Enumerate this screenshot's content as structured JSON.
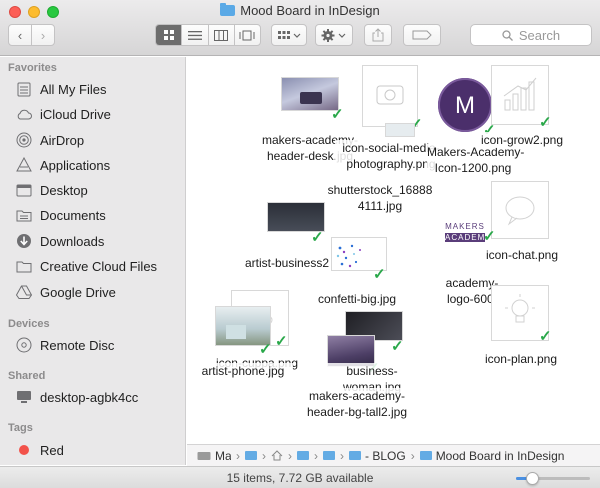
{
  "window": {
    "title": "Mood Board in InDesign"
  },
  "toolbar": {
    "back_glyph": "‹",
    "forward_glyph": "›",
    "share_glyph": "⇧",
    "search_placeholder": "Search"
  },
  "sidebar": {
    "sections": [
      {
        "label": "Favorites"
      },
      {
        "label": "Devices"
      },
      {
        "label": "Shared"
      },
      {
        "label": "Tags"
      }
    ],
    "favorites": [
      {
        "label": "All My Files",
        "icon": "all-files-icon"
      },
      {
        "label": "iCloud Drive",
        "icon": "cloud-icon"
      },
      {
        "label": "AirDrop",
        "icon": "airdrop-icon"
      },
      {
        "label": "Applications",
        "icon": "applications-icon"
      },
      {
        "label": "Desktop",
        "icon": "desktop-icon"
      },
      {
        "label": "Documents",
        "icon": "documents-icon"
      },
      {
        "label": "Downloads",
        "icon": "downloads-icon"
      },
      {
        "label": "Creative Cloud Files",
        "icon": "folder-icon"
      },
      {
        "label": "Google Drive",
        "icon": "google-drive-icon"
      }
    ],
    "devices": [
      {
        "label": "Remote Disc",
        "icon": "disc-icon"
      }
    ],
    "shared": [
      {
        "label": "desktop-agbk4cc",
        "icon": "computer-icon"
      }
    ],
    "tags": [
      {
        "label": "Red",
        "color": "#f2524a"
      }
    ]
  },
  "files": {
    "makers_academy_header_desk": "makers-academy-\nheader-desk.jpg",
    "icon_social_media_photography": "icon-social-media-\nphotography.png",
    "makers_academy_icon_1200": "Makers-Academy-\nIcon-1200.png",
    "icon_grow2": "icon-grow2.png",
    "shutterstock": "shutterstock_16888\n4111.jpg",
    "artist_business2": "artist-business2",
    "confetti_big": "confetti-big.jpg",
    "icon_chat": "icon-chat.png",
    "academy_logo_600": "academy-\nlogo-600.",
    "icon_cuppa": "icon-cuppa.png",
    "artist_phone": "artist-phone.jpg",
    "business_woman": "business-\nwoman.jpg",
    "makers_academy_header_bg_tall2": "makers-academy-\nheader-bg-tall2.jpg",
    "icon_plan": "icon-plan.png",
    "makers_logo_text_1": "MAKERS",
    "makers_logo_text_2": "ACADEMY"
  },
  "pathbar": {
    "items": [
      "Mac",
      "…",
      "…",
      "…",
      "…",
      "- BLOG",
      "Mood Board in InDesign"
    ]
  },
  "status": {
    "text": "15 items, 7.72 GB available",
    "zoom_fraction": 0.22
  },
  "colors": {
    "check": "#2aa84a",
    "accent": "#4a90e2",
    "folder": "#5aa9e6"
  }
}
